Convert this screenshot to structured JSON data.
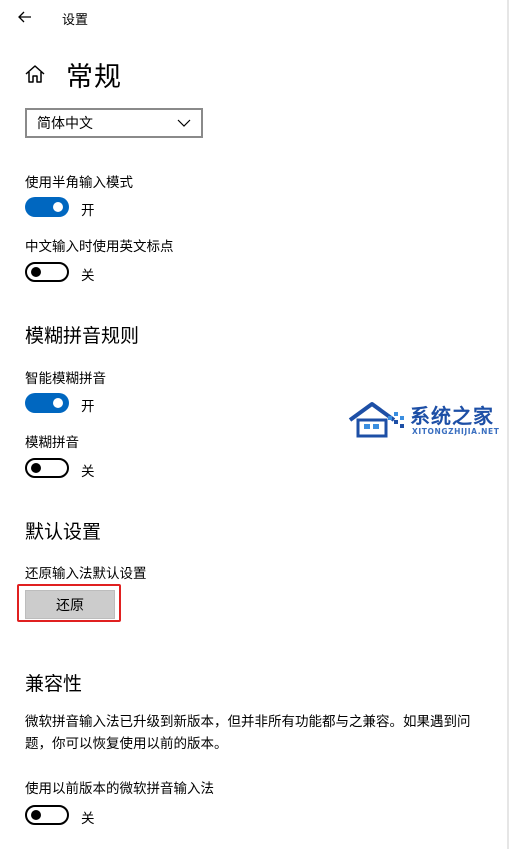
{
  "window": {
    "title": "设置"
  },
  "page": {
    "title": "常规"
  },
  "language_select": {
    "value": "简体中文"
  },
  "settings": [
    {
      "label": "使用半角输入模式",
      "state": "开",
      "on": true
    },
    {
      "label": "中文输入时使用英文标点",
      "state": "关",
      "on": false
    }
  ],
  "fuzzy": {
    "section_title": "模糊拼音规则",
    "items": [
      {
        "label": "智能模糊拼音",
        "state": "开",
        "on": true
      },
      {
        "label": "模糊拼音",
        "state": "关",
        "on": false
      }
    ]
  },
  "defaults": {
    "section_title": "默认设置",
    "label": "还原输入法默认设置",
    "button": "还原"
  },
  "compat": {
    "section_title": "兼容性",
    "description": "微软拼音输入法已升级到新版本，但并非所有功能都与之兼容。如果遇到问题，你可以恢复使用以前的版本。",
    "label": "使用以前版本的微软拼音输入法",
    "state": "关",
    "on": false
  },
  "watermark": {
    "title": "系统之家",
    "subtitle": "XITONGZHIJIA.NET"
  },
  "colors": {
    "accent": "#0067c0",
    "highlight": "#e02020",
    "button": "#cccccc"
  }
}
